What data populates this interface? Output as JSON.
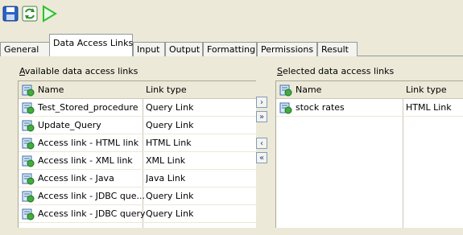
{
  "toolbar": {
    "buttons": [
      {
        "name": "save-icon",
        "color": "#1f5fbf"
      },
      {
        "name": "refresh-icon",
        "color": "#2f8f2f"
      },
      {
        "name": "run-icon",
        "color": "#2fbf2f"
      }
    ]
  },
  "tabs": [
    {
      "label": "General"
    },
    {
      "label": "Data Access Links",
      "active": true
    },
    {
      "label": "Input"
    },
    {
      "label": "Output"
    },
    {
      "label": "Formatting"
    },
    {
      "label": "Permissions"
    },
    {
      "label": "Result"
    }
  ],
  "available": {
    "title_accel": "A",
    "title_rest": "vailable data access links",
    "columns": [
      "Name",
      "Link type"
    ],
    "rows": [
      {
        "name": "Test_Stored_procedure",
        "type": "Query Link"
      },
      {
        "name": "Update_Query",
        "type": "Query Link"
      },
      {
        "name": "Access link - HTML link",
        "type": "HTML Link"
      },
      {
        "name": "Access link - XML link",
        "type": "XML Link"
      },
      {
        "name": "Access link - Java",
        "type": "Java Link"
      },
      {
        "name": "Access link - JDBC que...",
        "type": "Query Link"
      },
      {
        "name": "Access link - JDBC query",
        "type": "Query Link"
      }
    ]
  },
  "selected": {
    "title_accel": "S",
    "title_rest": "elected data access links",
    "columns": [
      "Name",
      "Link type"
    ],
    "rows": [
      {
        "name": "stock rates",
        "type": "HTML Link"
      }
    ]
  },
  "move_buttons": [
    {
      "name": "add-selected-button",
      "glyph": "›"
    },
    {
      "name": "add-all-button",
      "glyph": "»"
    },
    {
      "name": "remove-selected-button",
      "glyph": "‹"
    },
    {
      "name": "remove-all-button",
      "glyph": "«"
    }
  ]
}
